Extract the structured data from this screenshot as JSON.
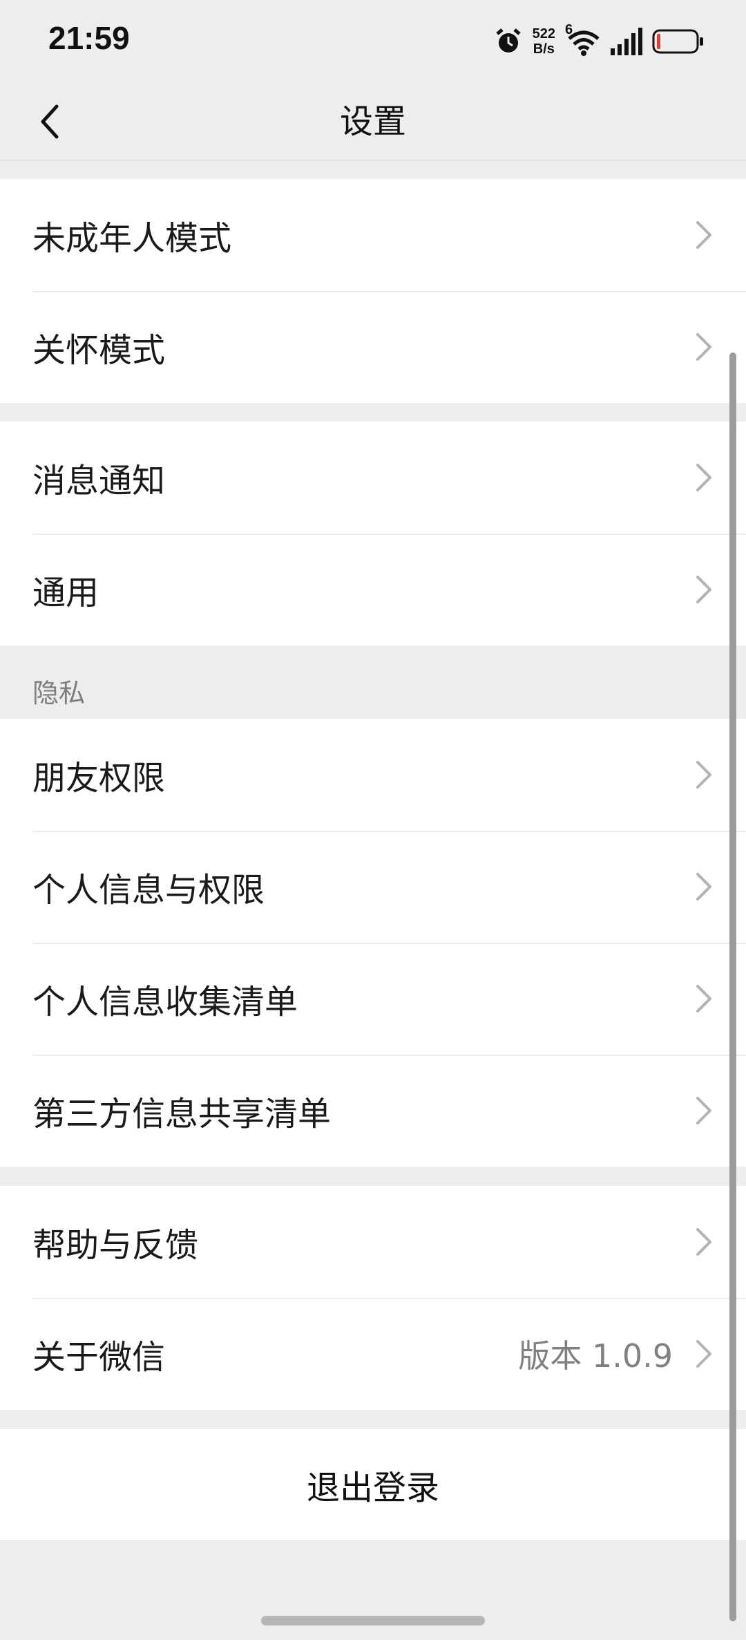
{
  "status_bar": {
    "time": "21:59",
    "net_speed_value": "522",
    "net_speed_unit": "B/s",
    "network_type": "6",
    "icons": [
      "alarm-icon",
      "wifi-icon",
      "signal-icon",
      "battery-icon"
    ]
  },
  "nav": {
    "title": "设置",
    "back_icon": "chevron-left-icon"
  },
  "groups": [
    {
      "items": [
        {
          "label": "未成年人模式"
        },
        {
          "label": "关怀模式"
        }
      ]
    },
    {
      "items": [
        {
          "label": "消息通知"
        },
        {
          "label": "通用"
        }
      ]
    },
    {
      "header": "隐私",
      "items": [
        {
          "label": "朋友权限"
        },
        {
          "label": "个人信息与权限"
        },
        {
          "label": "个人信息收集清单"
        },
        {
          "label": "第三方信息共享清单"
        }
      ]
    },
    {
      "items": [
        {
          "label": "帮助与反馈"
        },
        {
          "label": "关于微信",
          "value": "版本 1.0.9"
        }
      ]
    }
  ],
  "logout_label": "退出登录",
  "colors": {
    "background": "#ededed",
    "card": "#ffffff",
    "chevron": "#b3b3b3",
    "secondary_text": "#808080",
    "battery_low": "#e53935"
  }
}
